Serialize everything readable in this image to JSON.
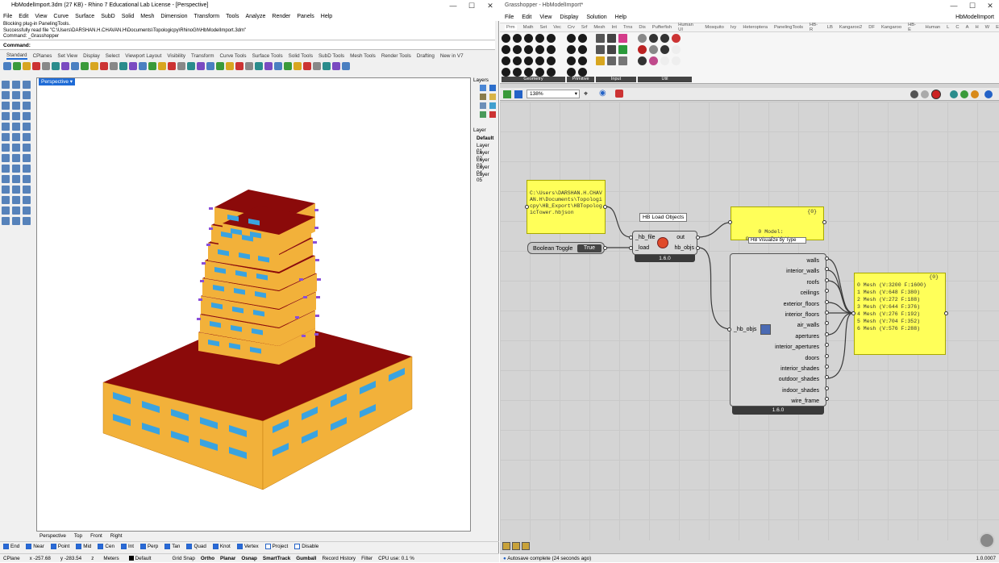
{
  "rhino": {
    "title": "HbModelImport.3dm (27 KB) - Rhino 7 Educational Lab License - [Perspective]",
    "menu": [
      "File",
      "Edit",
      "View",
      "Curve",
      "Surface",
      "SubD",
      "Solid",
      "Mesh",
      "Dimension",
      "Transform",
      "Tools",
      "Analyze",
      "Render",
      "Panels",
      "Help"
    ],
    "command_history": [
      "Blocking plug-in PanelingTools.",
      "Successfully read file \"C:\\Users\\DARSHAN.H.CHAVAN.H\\Documents\\Topologicpy\\RhinoGh\\HbModelImport.3dm\"",
      "Command: _Grasshopper"
    ],
    "command_label": "Command:",
    "tabs": [
      "Standard",
      "CPlanes",
      "Set View",
      "Display",
      "Select",
      "Viewport Layout",
      "Visibility",
      "Transform",
      "Curve Tools",
      "Surface Tools",
      "Solid Tools",
      "SubD Tools",
      "Mesh Tools",
      "Render Tools",
      "Drafting",
      "New in V7"
    ],
    "viewport_label": "Perspective",
    "viewport_tabs": [
      "Perspective",
      "Top",
      "Front",
      "Right"
    ],
    "layers_title": "Layers",
    "layer_header": "Layer",
    "layers": [
      "Default",
      "Layer 01",
      "Layer 02",
      "Layer 03",
      "Layer 04",
      "Layer 05"
    ],
    "osnaps": [
      {
        "label": "End",
        "on": true
      },
      {
        "label": "Near",
        "on": true
      },
      {
        "label": "Point",
        "on": true
      },
      {
        "label": "Mid",
        "on": true
      },
      {
        "label": "Cen",
        "on": true
      },
      {
        "label": "Int",
        "on": true
      },
      {
        "label": "Perp",
        "on": true
      },
      {
        "label": "Tan",
        "on": true
      },
      {
        "label": "Quad",
        "on": true
      },
      {
        "label": "Knot",
        "on": true
      },
      {
        "label": "Vertex",
        "on": true
      },
      {
        "label": "Project",
        "on": false
      },
      {
        "label": "Disable",
        "on": false
      }
    ],
    "status": {
      "cplane": "CPlane",
      "x": "x -257.68",
      "y": "y -283.54",
      "z": "z",
      "units": "Meters",
      "layer": "Default",
      "items": [
        "Grid Snap",
        "Ortho",
        "Planar",
        "Osnap",
        "SmartTrack",
        "Gumball",
        "Record History",
        "Filter",
        "CPU use: 0.1 %"
      ]
    },
    "colors": {
      "roof": "#8b0a0a",
      "wall": "#f2b13a",
      "window": "#3aa3e0",
      "shade": "#8a4fd8",
      "accent": "#1e6bd6"
    }
  },
  "gh": {
    "title": "Grasshopper - HbModelImport*",
    "title_right": "HbModelImport",
    "menu": [
      "File",
      "Edit",
      "View",
      "Display",
      "Solution",
      "Help"
    ],
    "tabs": [
      "Prm",
      "Math",
      "Set",
      "Vec",
      "Crv",
      "Srf",
      "Mesh",
      "Int",
      "Trns",
      "Dis",
      "Pufferfish",
      "Human UI",
      "Mosquito",
      "Ivy",
      "Heteroptera",
      "PanelingTools",
      "HB-R",
      "LB",
      "Kangaroo2",
      "DF",
      "Kangaroo",
      "HB-E",
      "Human",
      "L",
      "C",
      "A",
      "H",
      "W",
      "E"
    ],
    "ribbon_groups": [
      "Geometry",
      "Primitive",
      "Input",
      "Util"
    ],
    "zoom": "138%",
    "path_panel": "C:\\Users\\DARSHAN.H.CHAVAN.H\\Documents\\Topologicpy\\HB_Export\\HBTopologicTower.hbjson",
    "toggle_label": "Boolean Toggle",
    "toggle_value": "True",
    "hb_load": {
      "tooltip": "HB Load Objects",
      "in": [
        "_hb_file",
        "_load"
      ],
      "out": [
        "out",
        "hb_objs"
      ],
      "version": "1.6.0"
    },
    "model_panel": {
      "index": "{0}",
      "text": "0 Model:\n  Generic_Building"
    },
    "deconstruct": {
      "tooltip": "HB Visualize by Type",
      "in": "_hb_objs",
      "outputs": [
        "walls",
        "interior_walls",
        "roofs",
        "ceilings",
        "exterior_floors",
        "interior_floors",
        "air_walls",
        "apertures",
        "interior_apertures",
        "doors",
        "interior_shades",
        "outdoor_shades",
        "indoor_shades",
        "wire_frame"
      ],
      "version": "1.6.0"
    },
    "mesh_panel": {
      "index": "{0}",
      "rows": [
        "0 Mesh (V:3200  F:1600)",
        "1 Mesh (V:648  F:380)",
        "2 Mesh (V:272  F:188)",
        "3 Mesh (V:644  F:376)",
        "4 Mesh (V:276  F:192)",
        "5 Mesh (V:704  F:352)",
        "6 Mesh (V:576  F:288)"
      ]
    },
    "status": "Autosave complete (24 seconds ago)",
    "version": "1.0.0007"
  }
}
